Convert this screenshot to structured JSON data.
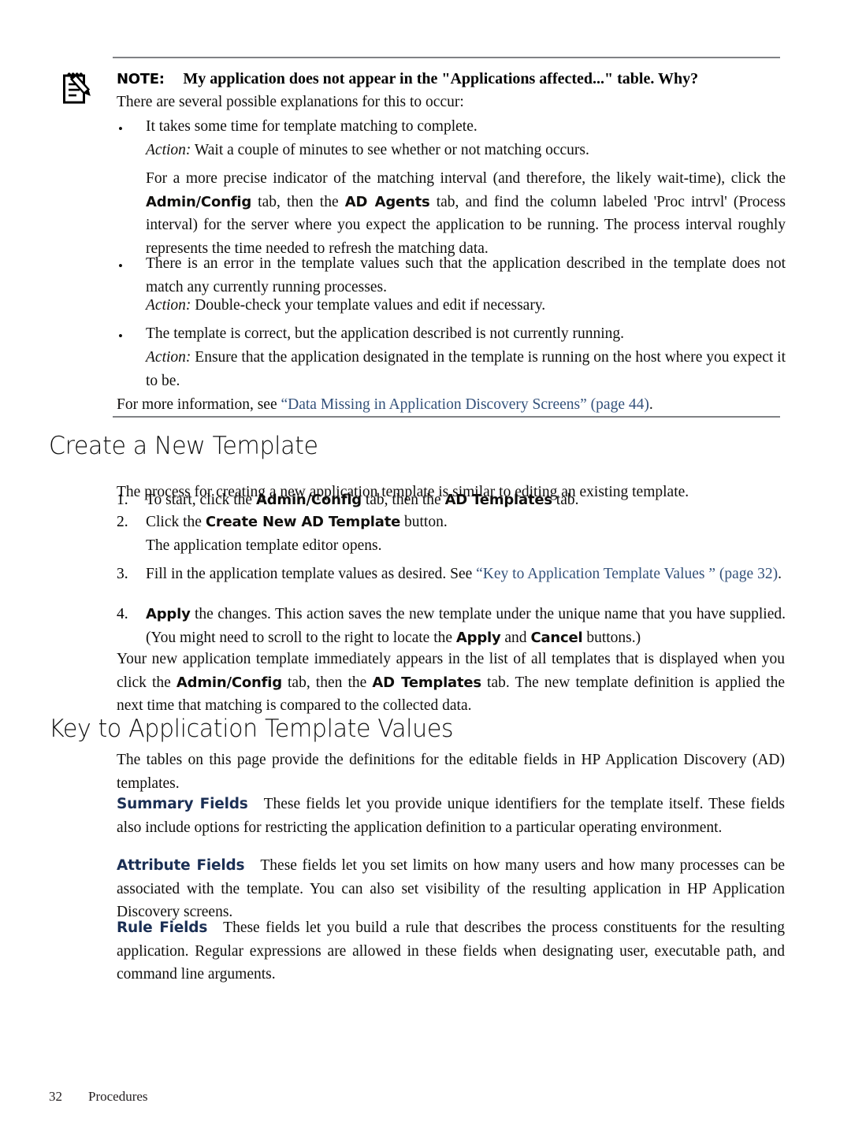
{
  "document": {
    "footer": {
      "page_number": "32",
      "section": "Procedures"
    }
  },
  "note": {
    "icon": "note-pencil-icon",
    "label": "NOTE:",
    "title": "My application does not appear in the \"Applications affected...\" table. Why?",
    "intro": "There are several possible explanations for this to occur:",
    "bullets": [
      {
        "marker": "•",
        "text": "It takes some time for template matching to complete.",
        "action_label": "Action:",
        "action_text": " Wait a couple of minutes to see whether or not matching occurs.",
        "followup_parts": [
          {
            "type": "text",
            "value": "For a more precise indicator of the matching interval (and therefore, the likely wait-time), click the "
          },
          {
            "type": "bold",
            "value": "Admin/Config"
          },
          {
            "type": "text",
            "value": " tab, then the "
          },
          {
            "type": "bold",
            "value": "AD Agents"
          },
          {
            "type": "text",
            "value": " tab, and find the column labeled 'Proc intrvl' (Process interval) for the server where you expect the application to be running. The process interval roughly represents the time needed to refresh the matching data."
          }
        ]
      },
      {
        "marker": "•",
        "text": "There is an error in the template values such that the application described in the template does not match any currently running processes.",
        "action_label": "Action:",
        "action_text": " Double-check your template values and edit if necessary."
      },
      {
        "marker": "•",
        "text": "The template is correct, but the application described is not currently running.",
        "action_label": "Action:",
        "action_text": " Ensure that the application designated in the template is running on the host where you expect it to be."
      }
    ],
    "more_info": {
      "lead": "For more information, see ",
      "link": "“Data Missing in Application Discovery Screens”",
      "page_ref": " (page 44)",
      "trail": "."
    }
  },
  "sections": [
    {
      "heading": "Create a New Template",
      "intro": "The process for creating a new application template is similar to editing an existing template.",
      "steps": [
        {
          "number": "1.",
          "parts": [
            {
              "type": "text",
              "value": "To start, click the "
            },
            {
              "type": "bold",
              "value": "Admin/Config"
            },
            {
              "type": "text",
              "value": " tab, then the "
            },
            {
              "type": "bold",
              "value": "AD Templates"
            },
            {
              "type": "text",
              "value": " tab."
            }
          ]
        },
        {
          "number": "2.",
          "parts": [
            {
              "type": "text",
              "value": "Click the "
            },
            {
              "type": "bold",
              "value": "Create New AD Template"
            },
            {
              "type": "text",
              "value": " button."
            }
          ],
          "sub": "The application template editor opens."
        },
        {
          "number": "3.",
          "parts": [
            {
              "type": "text",
              "value": "Fill in the application template values as desired. See "
            },
            {
              "type": "link",
              "value": "“Key to Application Template Values ” (page 32)"
            },
            {
              "type": "text",
              "value": "."
            }
          ]
        },
        {
          "number": "4.",
          "parts": [
            {
              "type": "bold",
              "value": "Apply"
            },
            {
              "type": "text",
              "value": " the changes. This action saves the new template under the unique name that you have supplied. (You might need to scroll to the right to locate the "
            },
            {
              "type": "bold",
              "value": "Apply"
            },
            {
              "type": "text",
              "value": " and "
            },
            {
              "type": "bold",
              "value": "Cancel"
            },
            {
              "type": "text",
              "value": " buttons.)"
            }
          ]
        }
      ],
      "outro_parts": [
        {
          "type": "text",
          "value": "Your new application template immediately appears in the list of all templates that is displayed when you click the "
        },
        {
          "type": "bold",
          "value": "Admin/Config"
        },
        {
          "type": "text",
          "value": " tab, then the "
        },
        {
          "type": "bold",
          "value": "AD Templates"
        },
        {
          "type": "text",
          "value": " tab. The new template definition is applied the next time that matching is compared to the collected data."
        }
      ]
    },
    {
      "heading": "Key to Application Template Values",
      "intro": "The tables on this page provide the definitions for the editable fields in HP Application Discovery (AD) templates.",
      "definitions": [
        {
          "label": "Summary Fields",
          "text": "These fields let you provide unique identifiers for the template itself. These fields also include options for restricting the application definition to a particular operating environment."
        },
        {
          "label": "Attribute Fields",
          "text": "These fields let you set limits on how many users and how many processes can be associated with the template. You can also set visibility of the resulting application in HP Application Discovery screens."
        },
        {
          "label": "Rule Fields",
          "text": "These fields let you build a rule that describes the process constituents for the resulting application. Regular expressions are allowed in these fields when designating user, executable path, and command line arguments."
        }
      ]
    }
  ],
  "colors": {
    "link": "#33517a",
    "field_label": "#1b2f54",
    "rule": "#808285",
    "body_text": "#100f0d"
  }
}
